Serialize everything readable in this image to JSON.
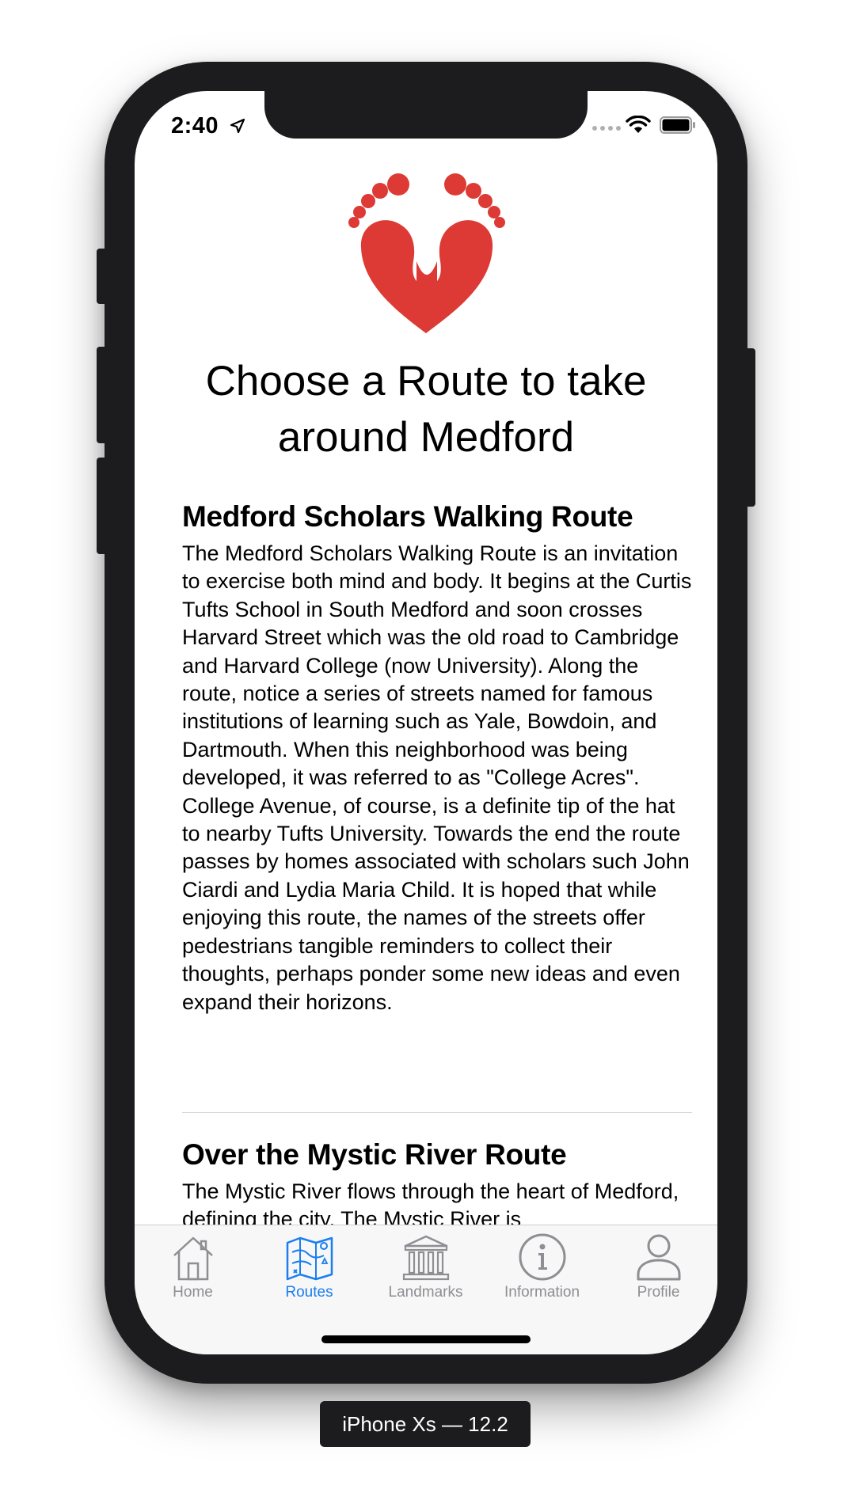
{
  "status_bar": {
    "time": "2:40",
    "location_icon": "location-arrow-icon",
    "signal_icon": "signal-dots-icon",
    "wifi_icon": "wifi-icon",
    "battery_icon": "battery-icon"
  },
  "logo": {
    "icon": "footprints-heart-icon",
    "color": "#dd3a35"
  },
  "page_title": "Choose a Route to take around Medford",
  "routes": [
    {
      "title": "Medford Scholars Walking Route",
      "description": "The Medford Scholars Walking Route is an invitation to exercise both mind and body. It begins at the Curtis Tufts School in South Medford and soon crosses Harvard Street which was the old road to Cambridge and Harvard College (now University). Along the route, notice a series of streets named for famous institutions of learning such as Yale, Bowdoin, and Dartmouth. When this neighborhood was being developed, it was referred to as \"College Acres\". College Avenue, of course, is a definite tip of the hat to nearby Tufts University. Towards the end the route passes by homes associated with scholars such John Ciardi and Lydia Maria Child. It is hoped that while enjoying this route, the names of the streets offer pedestrians tangible reminders to collect their thoughts, perhaps ponder some new ideas and even expand their horizons."
    },
    {
      "title": "Over the Mystic River Route",
      "description": "The Mystic River flows through the heart of Medford, defining the city. The Mystic River is"
    }
  ],
  "tab_bar": {
    "active_color": "#1a7ef0",
    "inactive_color": "#8e8e93",
    "tabs": [
      {
        "label": "Home",
        "icon": "home-icon",
        "active": false
      },
      {
        "label": "Routes",
        "icon": "map-icon",
        "active": true
      },
      {
        "label": "Landmarks",
        "icon": "landmark-icon",
        "active": false
      },
      {
        "label": "Information",
        "icon": "info-icon",
        "active": false
      },
      {
        "label": "Profile",
        "icon": "profile-icon",
        "active": false
      }
    ]
  },
  "device_label": "iPhone Xs — 12.2"
}
